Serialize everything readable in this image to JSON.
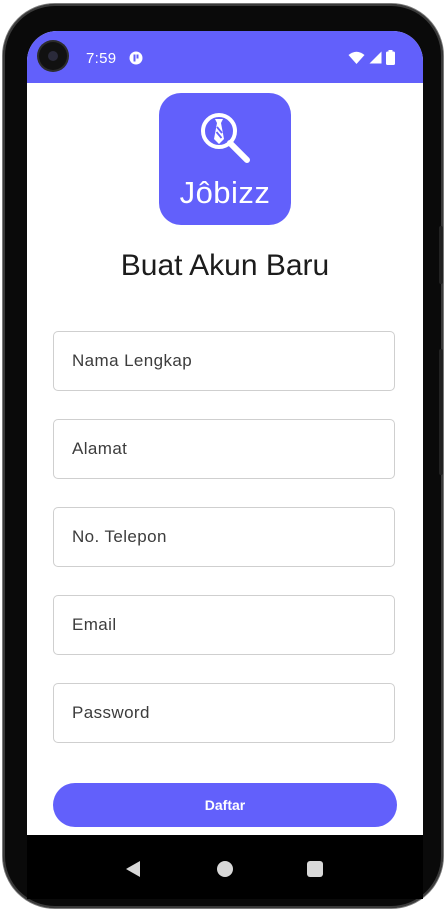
{
  "status_bar": {
    "time": "7:59",
    "notification_icon": "app-notification-icon",
    "icons": [
      "wifi-icon",
      "cell-signal-icon",
      "battery-icon"
    ],
    "background_color": "#6260fb"
  },
  "logo": {
    "text": "Jôbizz",
    "icon": "search-magnifier-tie-icon",
    "background_color": "#6260fb"
  },
  "title": "Buat Akun Baru",
  "form": {
    "fields": [
      {
        "placeholder": "Nama Lengkap",
        "value": ""
      },
      {
        "placeholder": "Alamat",
        "value": ""
      },
      {
        "placeholder": "No. Telepon",
        "value": ""
      },
      {
        "placeholder": "Email",
        "value": ""
      },
      {
        "placeholder": "Password",
        "value": ""
      }
    ],
    "submit_label": "Daftar"
  },
  "nav_bar": {
    "icons": [
      "back-icon",
      "home-icon",
      "recent-apps-icon"
    ]
  }
}
